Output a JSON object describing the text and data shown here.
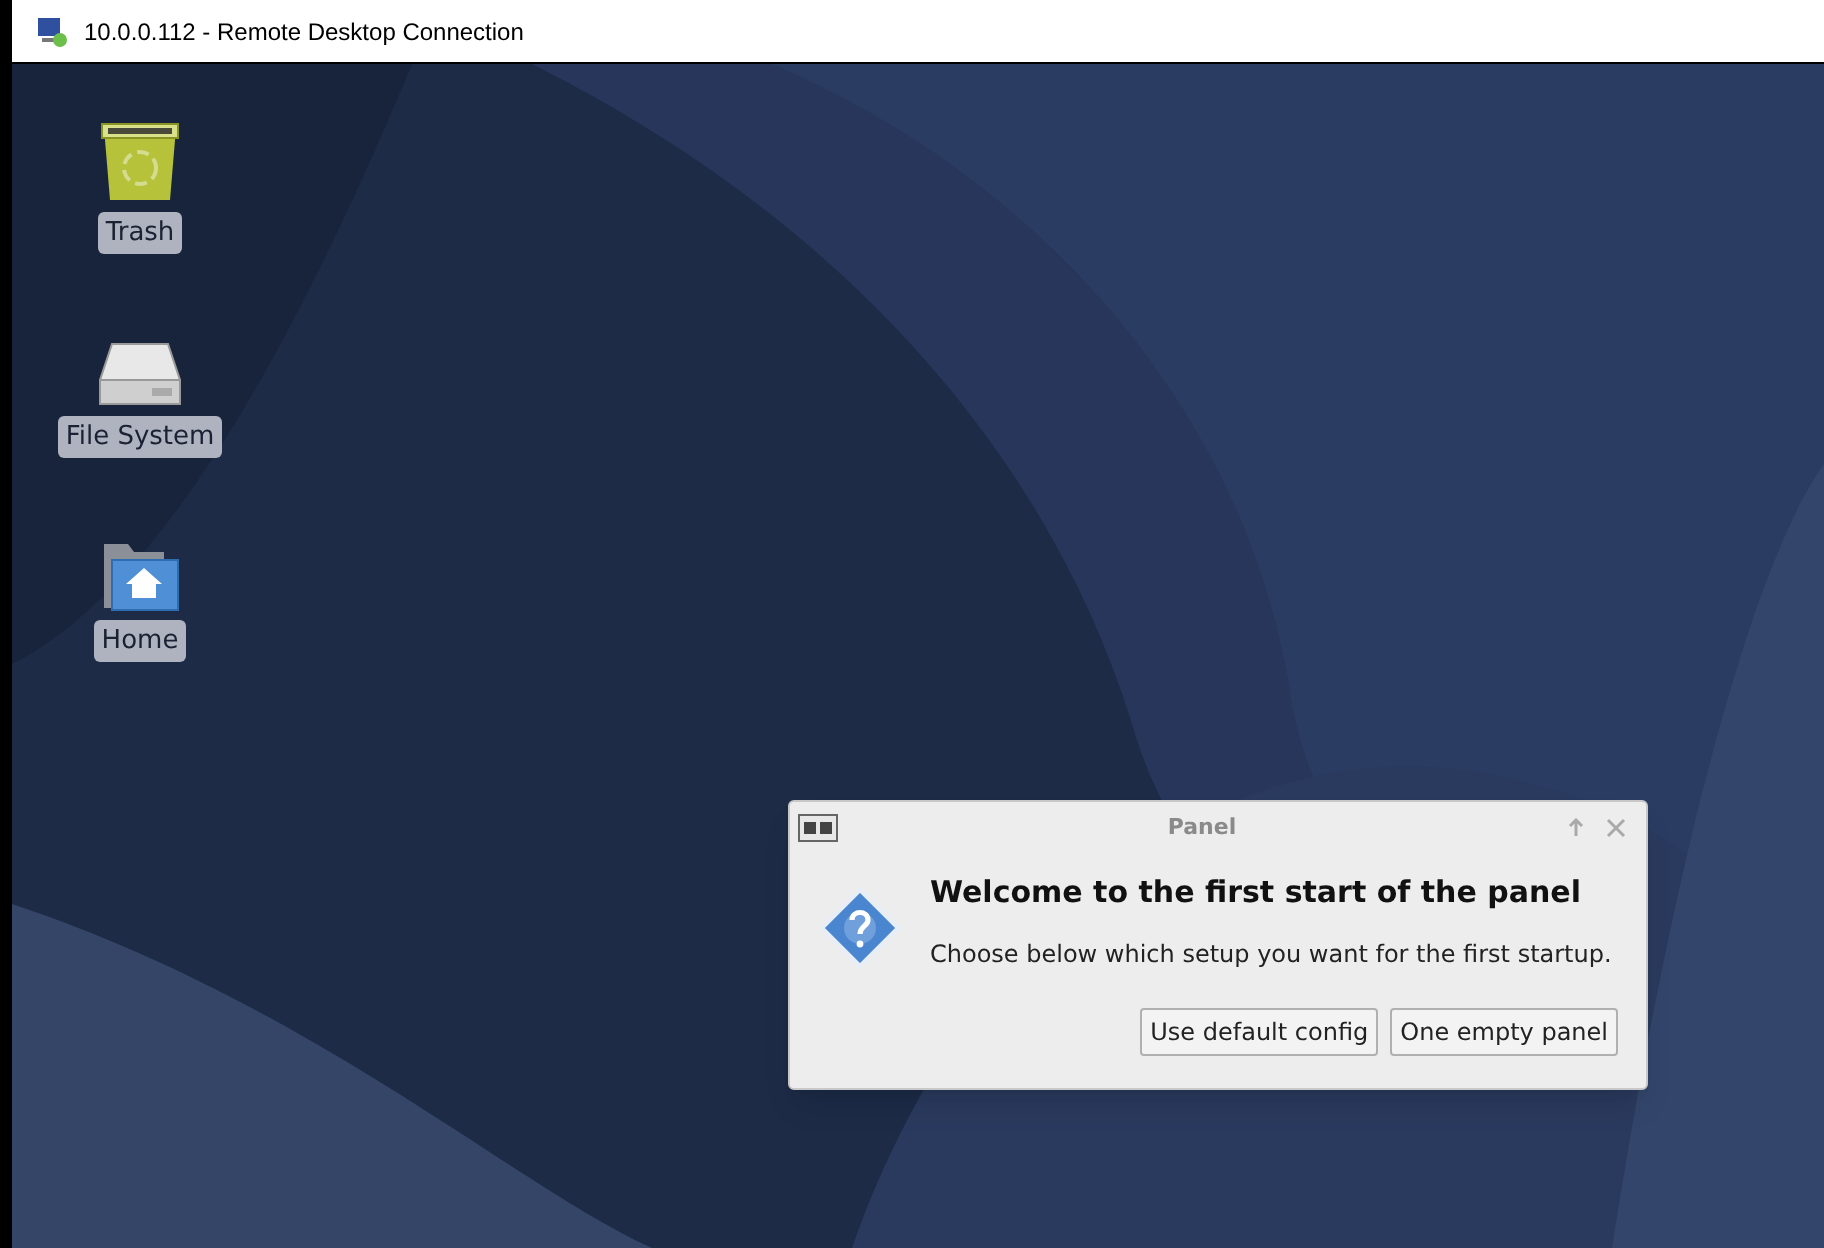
{
  "window": {
    "title": "10.0.0.112 - Remote Desktop Connection"
  },
  "desktop_icons": [
    {
      "kind": "trash",
      "label": "Trash"
    },
    {
      "kind": "drive",
      "label": "File System"
    },
    {
      "kind": "home",
      "label": "Home"
    }
  ],
  "dialog": {
    "title": "Panel",
    "heading": "Welcome to the first start of the panel",
    "message": "Choose below which setup you want for the first startup.",
    "buttons": [
      "Use default config",
      "One empty panel"
    ]
  }
}
